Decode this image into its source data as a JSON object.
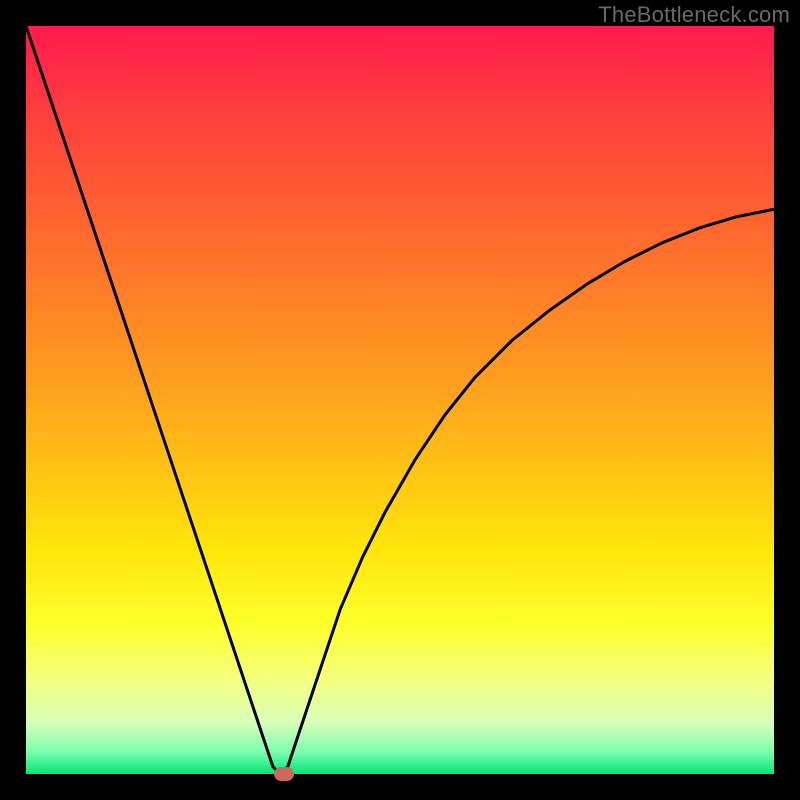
{
  "watermark": "TheBottleneck.com",
  "chart_data": {
    "type": "line",
    "title": "",
    "xlabel": "",
    "ylabel": "",
    "xlim": [
      0,
      100
    ],
    "ylim": [
      0,
      100
    ],
    "x": [
      0,
      2,
      4,
      6,
      8,
      10,
      12,
      14,
      16,
      18,
      20,
      22,
      24,
      26,
      28,
      30,
      32,
      33,
      34,
      35,
      36,
      38,
      40,
      42,
      45,
      48,
      52,
      56,
      60,
      65,
      70,
      75,
      80,
      85,
      90,
      95,
      100
    ],
    "values": [
      100,
      94,
      88,
      82,
      76,
      70,
      64,
      58,
      52,
      46,
      40,
      34,
      28,
      22,
      16,
      10,
      4,
      1,
      0,
      1,
      4,
      10,
      16,
      22,
      29,
      35,
      42,
      48,
      53,
      58,
      62,
      65.5,
      68.5,
      71,
      73,
      74.5,
      75.5
    ],
    "marker": {
      "x": 34.5,
      "y": 0
    },
    "annotations": []
  },
  "colors": {
    "curve": "#000000",
    "marker": "#c96a5a"
  }
}
